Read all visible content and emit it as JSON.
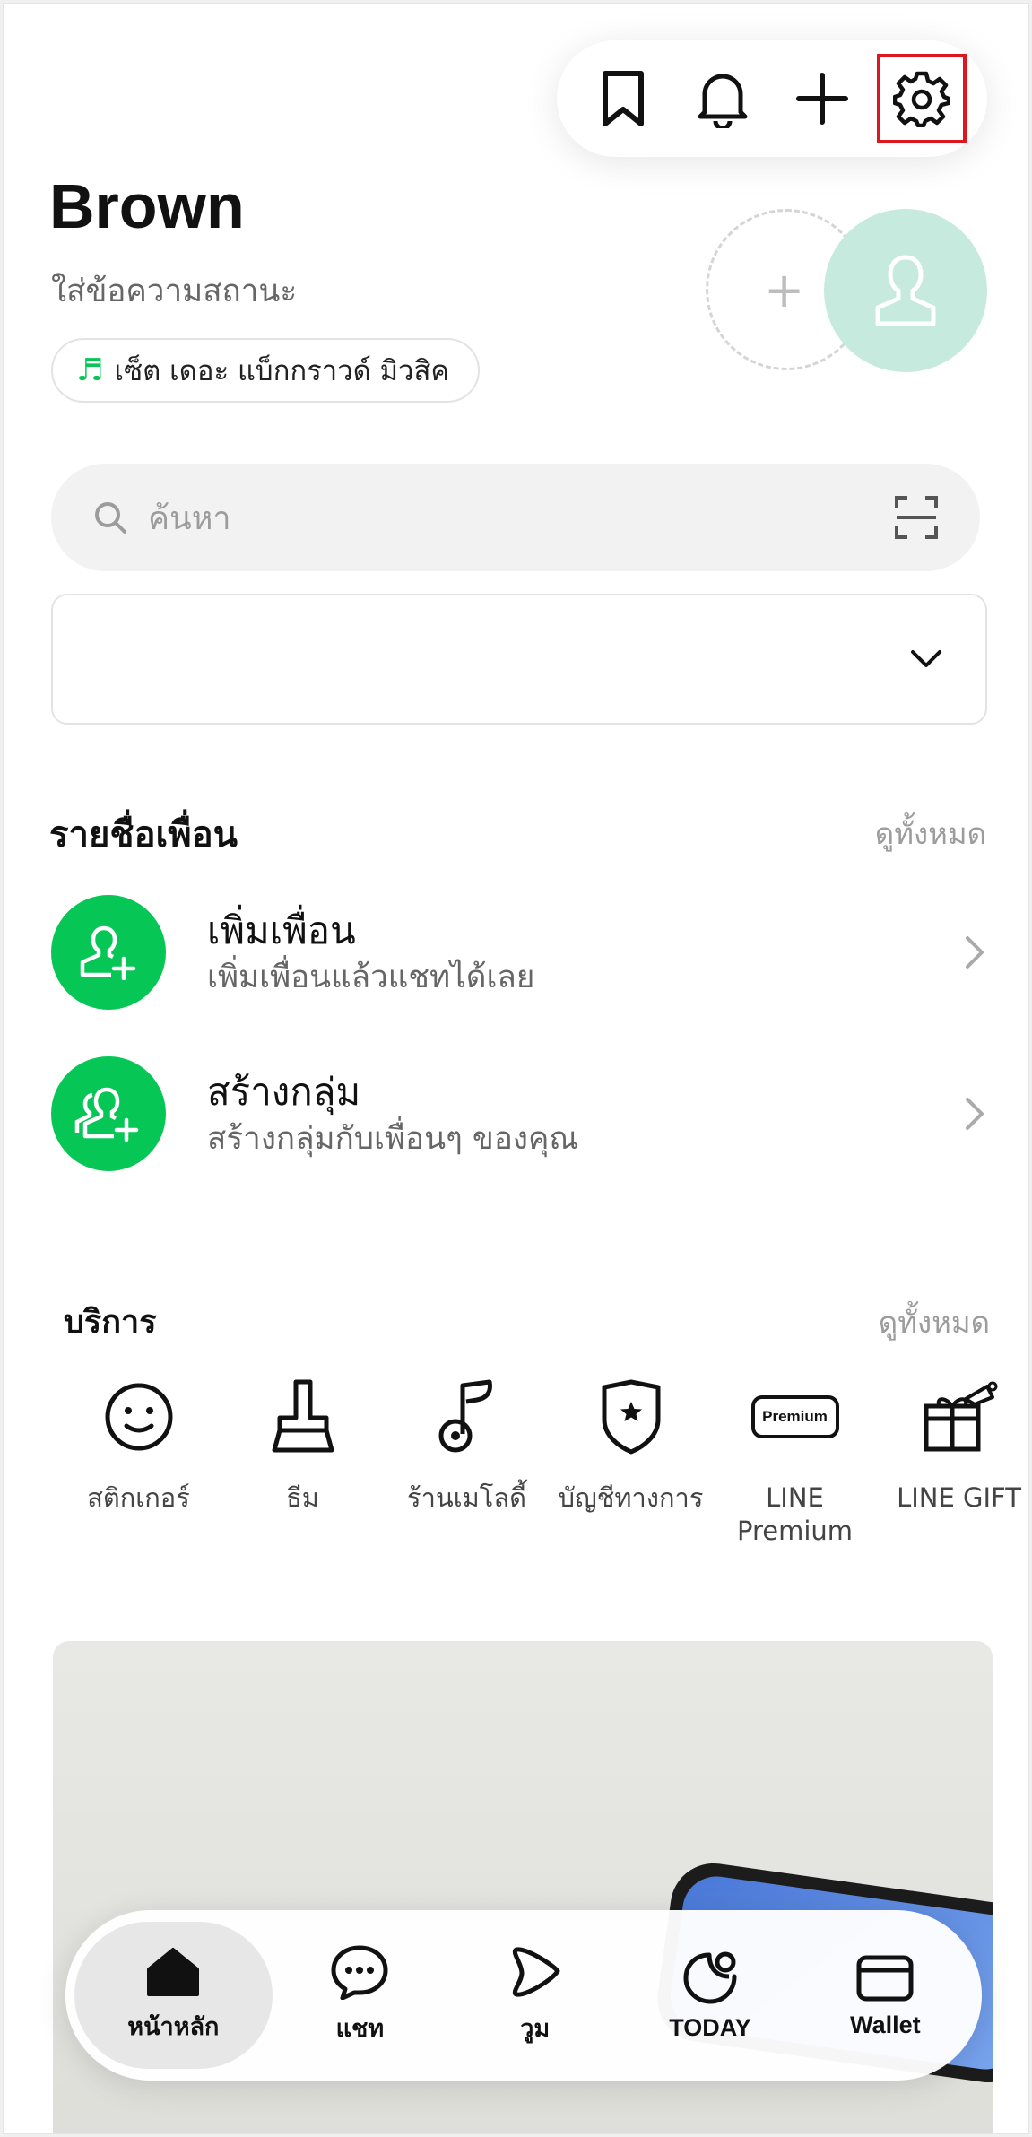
{
  "header": {
    "icons": [
      "bookmark-icon",
      "bell-icon",
      "plus-icon",
      "gear-icon"
    ],
    "highlight_color": "#e0161e"
  },
  "profile": {
    "name": "Brown",
    "status_placeholder": "ใส่ข้อความสถานะ",
    "music": "เซ็ต เดอะ แบ็กกราวด์ มิวสิค",
    "add_story_symbol": "+"
  },
  "search": {
    "placeholder": "ค้นหา"
  },
  "friends": {
    "title": "รายชื่อเพื่อน",
    "see_all": "ดูทั้งหมด",
    "items": [
      {
        "title": "เพิ่มเพื่อน",
        "subtitle": "เพิ่มเพื่อนแล้วแชทได้เลย",
        "icon": "add-friend-icon"
      },
      {
        "title": "สร้างกลุ่ม",
        "subtitle": "สร้างกลุ่มกับเพื่อนๆ ของคุณ",
        "icon": "create-group-icon"
      }
    ]
  },
  "services": {
    "title": "บริการ",
    "see_all": "ดูทั้งหมด",
    "items": [
      {
        "label": "สติกเกอร์",
        "icon": "sticker-icon"
      },
      {
        "label": "ธีม",
        "icon": "theme-brush-icon"
      },
      {
        "label": "ร้านเมโลดี้",
        "icon": "melody-note-icon"
      },
      {
        "label": "บัญชีทางการ",
        "icon": "official-account-shield-icon"
      },
      {
        "label": "LINE Premium",
        "icon": "premium-badge-icon",
        "badge_text": "Premium"
      },
      {
        "label": "LINE GIFT",
        "icon": "gift-icon"
      }
    ]
  },
  "nav": {
    "items": [
      {
        "label": "หน้าหลัก",
        "icon": "home-icon",
        "active": true
      },
      {
        "label": "แชท",
        "icon": "chat-icon",
        "active": false
      },
      {
        "label": "วูม",
        "icon": "voom-play-icon",
        "active": false
      },
      {
        "label": "TODAY",
        "icon": "today-icon",
        "active": false
      },
      {
        "label": "Wallet",
        "icon": "wallet-icon",
        "active": false
      }
    ]
  },
  "colors": {
    "accent": "#06c755",
    "avatar_bg": "#c6eadd"
  }
}
